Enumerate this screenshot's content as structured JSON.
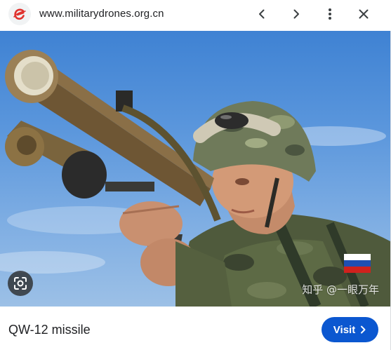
{
  "header": {
    "site_url": "www.militarydrones.org.cn",
    "logo_icon": "site-favicon-e-icon",
    "logo_color": "#e0322e",
    "actions": {
      "previous_icon": "chevron-left-icon",
      "next_icon": "chevron-right-icon",
      "more_icon": "more-vertical-icon",
      "close_icon": "close-icon"
    }
  },
  "image": {
    "subject": "soldier aiming shoulder-fired missile launcher",
    "watermark": "知乎 @一眼万年",
    "lens_icon": "google-lens-icon"
  },
  "footer": {
    "caption": "QW-12 missile",
    "visit_label": "Visit",
    "visit_icon": "chevron-right-icon",
    "accent": "#0b57d0"
  }
}
